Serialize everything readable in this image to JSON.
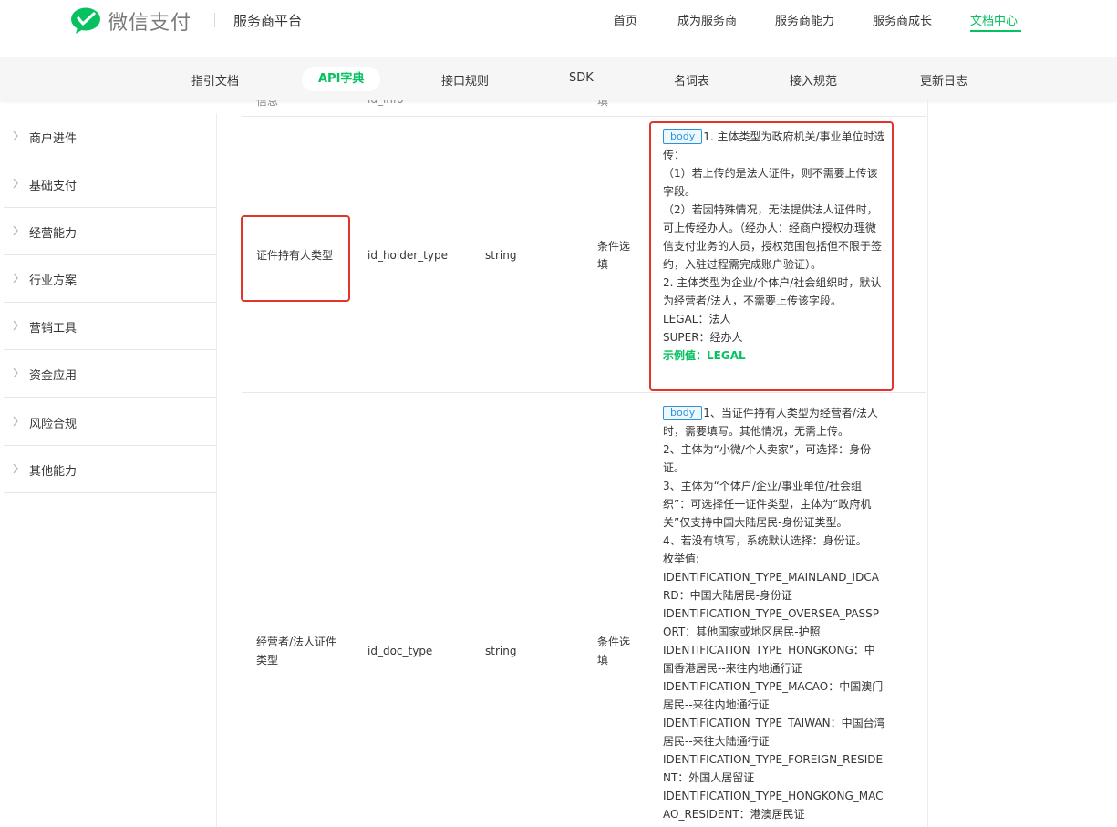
{
  "brand": {
    "logo_text": "微信支付",
    "platform": "服务商平台",
    "accent": "#07c160"
  },
  "main_nav": [
    {
      "label": "首页"
    },
    {
      "label": "成为服务商"
    },
    {
      "label": "服务商能力"
    },
    {
      "label": "服务商成长"
    },
    {
      "label": "文档中心",
      "active": true
    }
  ],
  "sub_nav": [
    {
      "label": "指引文档"
    },
    {
      "label": "API字典",
      "active": true
    },
    {
      "label": "接口规则"
    },
    {
      "label": "SDK"
    },
    {
      "label": "名词表"
    },
    {
      "label": "接入规范"
    },
    {
      "label": "更新日志"
    }
  ],
  "sidebar": {
    "items": [
      {
        "label": "商户进件",
        "icon": "chevron-right-icon"
      },
      {
        "label": "基础支付",
        "icon": "chevron-right-icon"
      },
      {
        "label": "经营能力",
        "icon": "chevron-right-icon"
      },
      {
        "label": "行业方案",
        "icon": "chevron-right-icon"
      },
      {
        "label": "营销工具",
        "icon": "chevron-right-icon"
      },
      {
        "label": "资金应用",
        "icon": "chevron-right-icon"
      },
      {
        "label": "风险合规",
        "icon": "chevron-right-icon"
      },
      {
        "label": "其他能力",
        "icon": "chevron-right-icon"
      }
    ]
  },
  "table": {
    "partial_row": {
      "name": "信息",
      "field": "id_info",
      "required": "填"
    },
    "rows": [
      {
        "name": "证件持有人类型",
        "field": "id_holder_type",
        "type": "string",
        "required": "条件选填",
        "badge": "body",
        "description": [
          "1. 主体类型为政府机关/事业单位时选传：",
          "（1）若上传的是法人证件，则不需要上传该字段。",
          "（2）若因特殊情况，无法提供法人证件时，可上传经办人。（经办人：经商户授权办理微信支付业务的人员，授权范围包括但不限于签约，入驻过程需完成账户验证）。",
          "2. 主体类型为企业/个体户/社会组织时，默认为经营者/法人，不需要上传该字段。",
          "LEGAL：法人",
          "SUPER：经办人"
        ],
        "example": "示例值：LEGAL",
        "highlighted": true
      },
      {
        "name": "经营者/法人证件类型",
        "field": "id_doc_type",
        "type": "string",
        "required": "条件选填",
        "badge": "body",
        "description": [
          "1、当证件持有人类型为经营者/法人时，需要填写。其他情况，无需上传。",
          "2、主体为“小微/个人卖家”，可选择：身份证。",
          "3、主体为“个体户/企业/事业单位/社会组织”：可选择任一证件类型，主体为“政府机关”仅支持中国大陆居民-身份证类型。",
          "4、若没有填写，系统默认选择：身份证。",
          "枚举值:",
          "IDENTIFICATION_TYPE_MAINLAND_IDCARD：中国大陆居民-身份证",
          "IDENTIFICATION_TYPE_OVERSEA_PASSPORT：其他国家或地区居民-护照",
          "IDENTIFICATION_TYPE_HONGKONG：中国香港居民--来往内地通行证",
          "IDENTIFICATION_TYPE_MACAO：中国澳门居民--来往内地通行证",
          "IDENTIFICATION_TYPE_TAIWAN：中国台湾居民--来往大陆通行证",
          "IDENTIFICATION_TYPE_FOREIGN_RESIDENT：外国人居留证",
          "IDENTIFICATION_TYPE_HONGKONG_MACAO_RESIDENT：港澳居民证"
        ]
      }
    ]
  }
}
